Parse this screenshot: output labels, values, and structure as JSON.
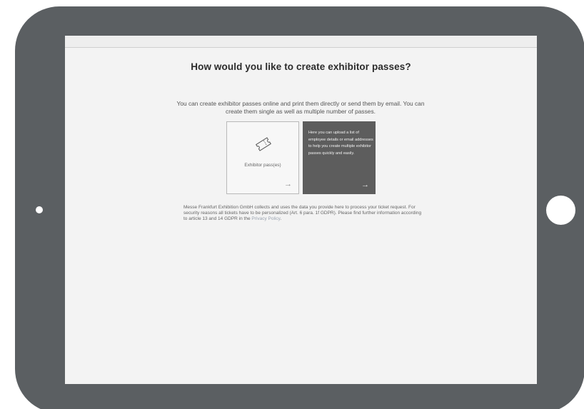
{
  "page": {
    "heading": "How would you like to create exhibitor passes?",
    "intro": "You can create exhibitor passes online and print them directly or send them by email. You can create them single as well as multiple number of passes."
  },
  "options": {
    "single": {
      "label": "Exhibitor pass(es)",
      "icon": "ticket-icon",
      "arrow": "→"
    },
    "upload": {
      "text": "Here you can upload a list of employee details or email addresses to help you create multiple exhibitor passes quickly and easily.",
      "arrow": "→"
    }
  },
  "privacy": {
    "text": "Messe Frankfurt Exhibition GmbH collects and uses the data you provide here to process your ticket request. For security reasons all tickets have to be personalized (Art. 6 para. 1f GDPR). Please find further information according to article 13 and 14 GDPR in the ",
    "link": "Privacy Policy",
    "end": "."
  },
  "colors": {
    "device": "#5b5f62",
    "screen": "#f3f3f3",
    "upload_card": "#5d5d5d",
    "link": "#9aa3b0"
  }
}
